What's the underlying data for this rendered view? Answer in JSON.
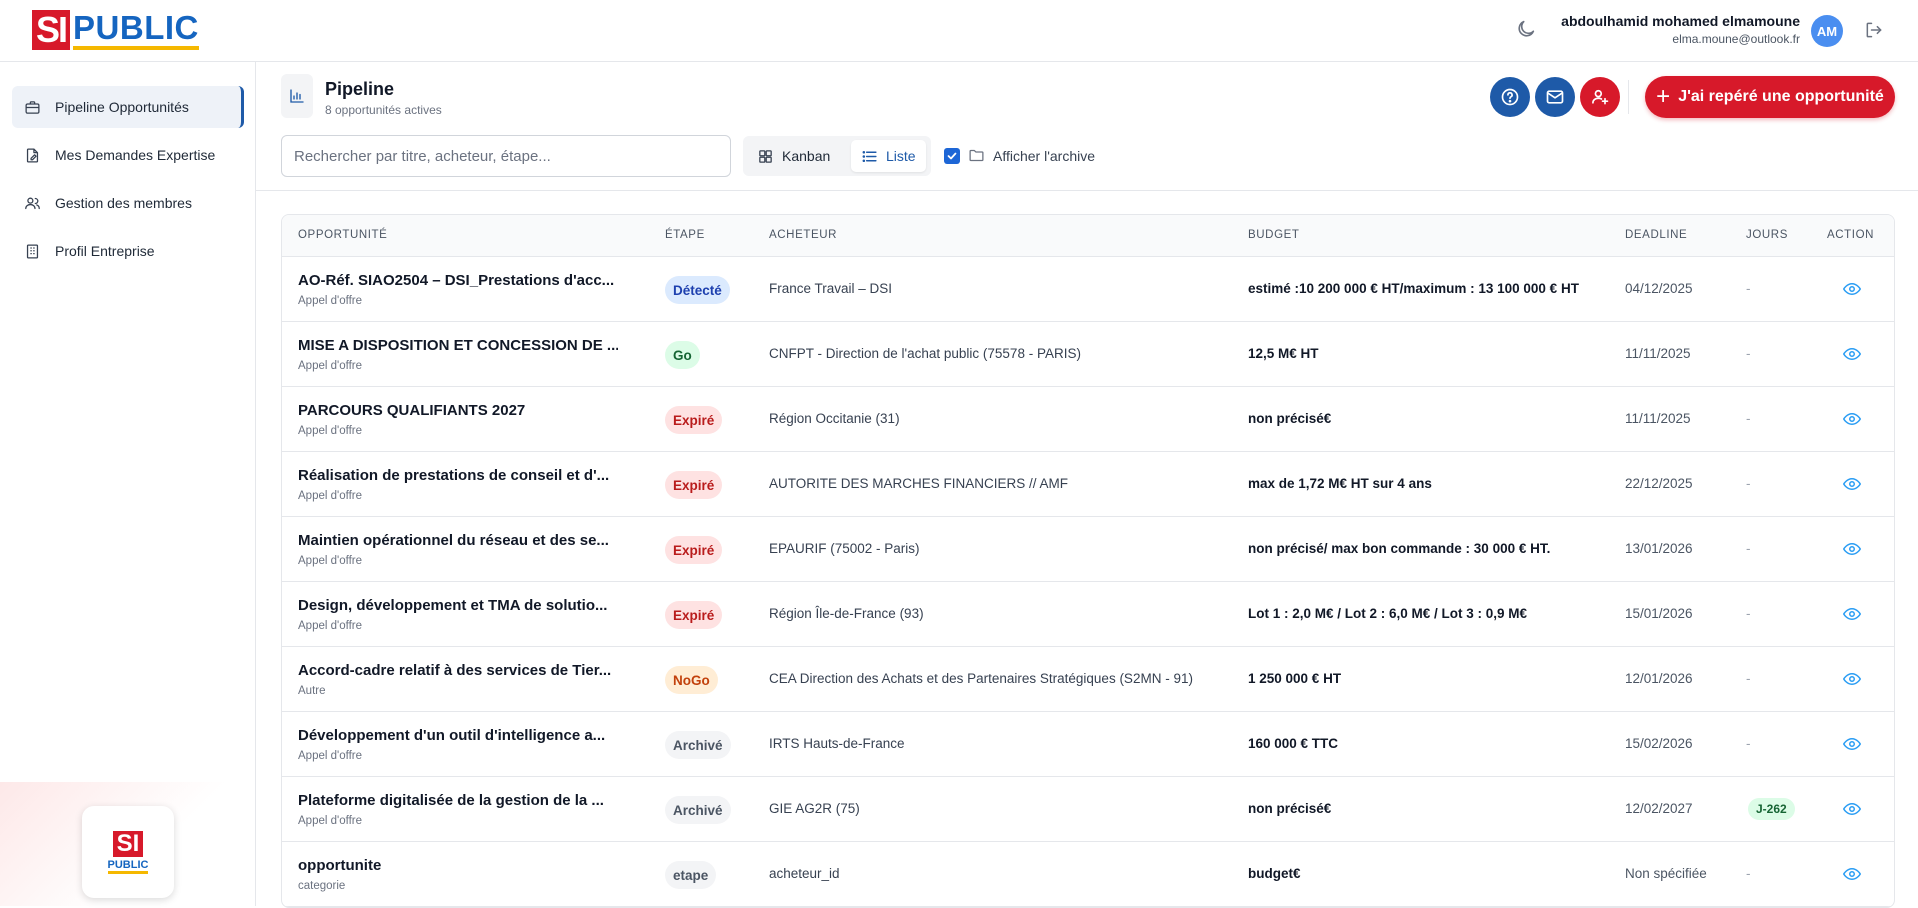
{
  "brand": {
    "si": "SI",
    "public": "PUBLIC"
  },
  "user": {
    "name": "abdoulhamid mohamed elmamoune",
    "email": "elma.moune@outlook.fr",
    "initials": "AM"
  },
  "sidebar": {
    "items": [
      {
        "label": "Pipeline Opportunités",
        "icon": "briefcase-icon",
        "active": true
      },
      {
        "label": "Mes Demandes Expertise",
        "icon": "document-edit-icon",
        "active": false
      },
      {
        "label": "Gestion des membres",
        "icon": "users-icon",
        "active": false
      },
      {
        "label": "Profil Entreprise",
        "icon": "building-icon",
        "active": false
      }
    ]
  },
  "header": {
    "title": "Pipeline",
    "subtitle": "8 opportunités actives",
    "cta_label": "J'ai repéré une opportunité"
  },
  "toolbar": {
    "search_placeholder": "Rechercher par titre, acheteur, étape...",
    "view_kanban": "Kanban",
    "view_list": "Liste",
    "show_archive": "Afficher l'archive",
    "show_archive_checked": true
  },
  "table": {
    "columns": [
      "OPPORTUNITÉ",
      "ÉTAPE",
      "ACHETEUR",
      "BUDGET",
      "DEADLINE",
      "JOURS",
      "ACTION"
    ],
    "rows": [
      {
        "title": "AO-Réf. SIAO2504 – DSI_Prestations d'acc...",
        "category": "Appel d'offre",
        "stage": "Détecté",
        "stage_kind": "detected",
        "buyer": "France Travail – DSI",
        "budget": "estimé :10 200 000 € HT/maximum : 13 100 000 € HT",
        "deadline": "04/12/2025",
        "days": "-"
      },
      {
        "title": "MISE A DISPOSITION ET CONCESSION DE ...",
        "category": "Appel d'offre",
        "stage": "Go",
        "stage_kind": "go",
        "buyer": "CNFPT - Direction de l'achat public (75578 - PARIS)",
        "budget": "12,5 M€ HT",
        "deadline": "11/11/2025",
        "days": "-"
      },
      {
        "title": "PARCOURS QUALIFIANTS 2027",
        "category": "Appel d'offre",
        "stage": "Expiré",
        "stage_kind": "expired",
        "buyer": "Région Occitanie (31)",
        "budget": "non précisé€",
        "deadline": "11/11/2025",
        "days": "-"
      },
      {
        "title": "Réalisation de prestations de conseil et d'...",
        "category": "Appel d'offre",
        "stage": "Expiré",
        "stage_kind": "expired",
        "buyer": "AUTORITE DES MARCHES FINANCIERS // AMF",
        "budget": "max de 1,72 M€ HT sur 4 ans",
        "deadline": "22/12/2025",
        "days": "-"
      },
      {
        "title": "Maintien opérationnel du réseau et des se...",
        "category": "Appel d'offre",
        "stage": "Expiré",
        "stage_kind": "expired",
        "buyer": "EPAURIF (75002 - Paris)",
        "budget": "non précisé/ max bon commande : 30 000 € HT.",
        "deadline": "13/01/2026",
        "days": "-"
      },
      {
        "title": "Design, développement et TMA de solutio...",
        "category": "Appel d'offre",
        "stage": "Expiré",
        "stage_kind": "expired",
        "buyer": "Région Île-de-France (93)",
        "budget": "Lot 1 : 2,0 M€ / Lot 2 : 6,0 M€ / Lot 3 : 0,9 M€",
        "deadline": "15/01/2026",
        "days": "-"
      },
      {
        "title": "Accord-cadre relatif à des services de Tier...",
        "category": "Autre",
        "stage": "NoGo",
        "stage_kind": "nogo",
        "buyer": "CEA Direction des Achats et des Partenaires Stratégiques (S2MN - 91)",
        "budget": "1 250 000 € HT",
        "deadline": "12/01/2026",
        "days": "-"
      },
      {
        "title": "Développement d'un outil d'intelligence a...",
        "category": "Appel d'offre",
        "stage": "Archivé",
        "stage_kind": "archived",
        "buyer": "IRTS Hauts-de-France",
        "budget": "160 000 € TTC",
        "deadline": "15/02/2026",
        "days": "-"
      },
      {
        "title": "Plateforme digitalisée de la gestion de la ...",
        "category": "Appel d'offre",
        "stage": "Archivé",
        "stage_kind": "archived",
        "buyer": "GIE AG2R (75)",
        "budget": "non précisé€",
        "deadline": "12/02/2027",
        "days": "J-262"
      },
      {
        "title": "opportunite",
        "category": "categorie",
        "stage": "etape",
        "stage_kind": "archived",
        "buyer": "acheteur_id",
        "budget": "budget€",
        "deadline": "Non spécifiée",
        "days": "-"
      }
    ]
  },
  "colors": {
    "brand_red": "#d7192a",
    "brand_blue": "#1565c0",
    "brand_yellow": "#f5b800",
    "primary_blue": "#1e5aa8",
    "stage_detected": "#dbeafe",
    "stage_go": "#dcfce7",
    "stage_expired": "#fee2e2",
    "stage_nogo": "#ffedd5",
    "stage_archived": "#f3f4f6"
  }
}
